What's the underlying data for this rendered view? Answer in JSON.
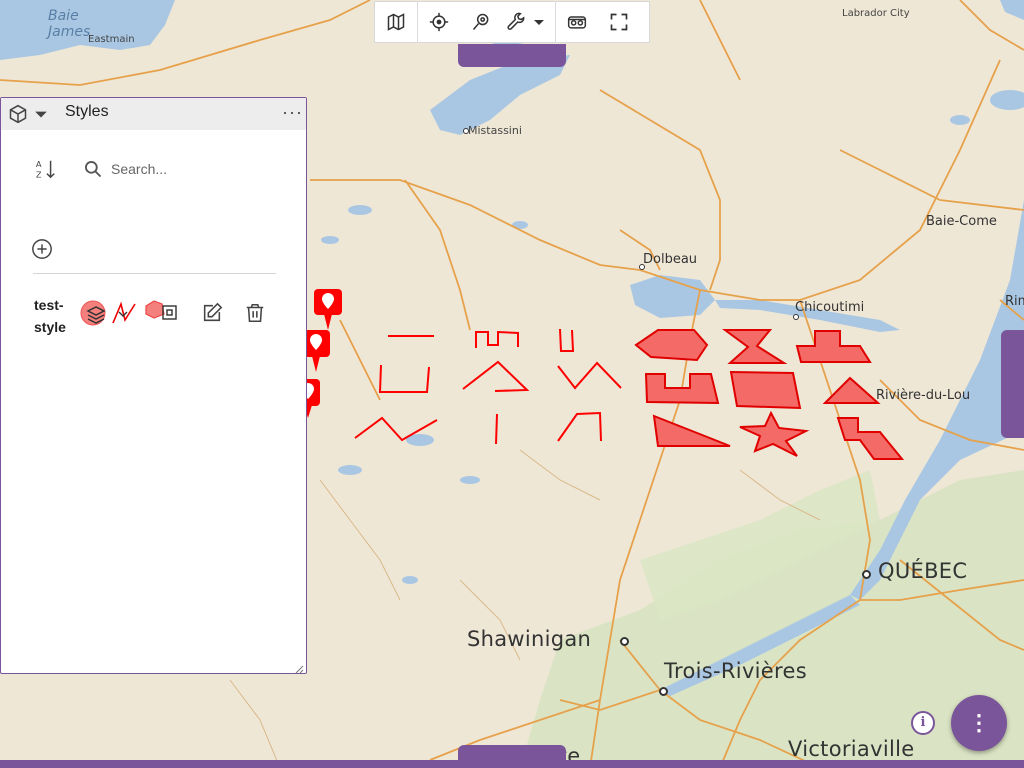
{
  "map": {
    "labels": {
      "baie_james": "Baie\nJames",
      "eastmain": "Eastmain",
      "mistassini": "Mistassini",
      "dolbeau": "Dolbeau",
      "chicoutimi": "Chicoutimi",
      "baie_comeau": "Baie-Come",
      "rim": "Rim",
      "riviere_du_loup": "Rivière-du-Lou",
      "labrador_city": "Labrador City",
      "quebec": "QUÉBEC",
      "shawinigan": "Shawinigan",
      "trois_rivieres": "Trois-Rivières",
      "joliette": "Joliette",
      "victoriaville": "Victoriaville"
    },
    "colors": {
      "land": "#efe7d6",
      "water": "#a9c7e3",
      "forest": "#cfe0b6",
      "road": "#e6a14b",
      "feature": "#ff0000",
      "feature_fill": "#f46a66",
      "accent": "#7b559a"
    }
  },
  "toolbar": {
    "icons": [
      "map-icon",
      "crosshair-icon",
      "search-location-icon",
      "wrench-icon",
      "caret-down-icon",
      "vr-icon",
      "fullscreen-icon"
    ]
  },
  "panel": {
    "title": "Styles",
    "search_placeholder": "Search...",
    "style_item": {
      "name": "test-style"
    }
  },
  "fab": {
    "label": "⋮"
  },
  "info": {
    "label": "i"
  }
}
